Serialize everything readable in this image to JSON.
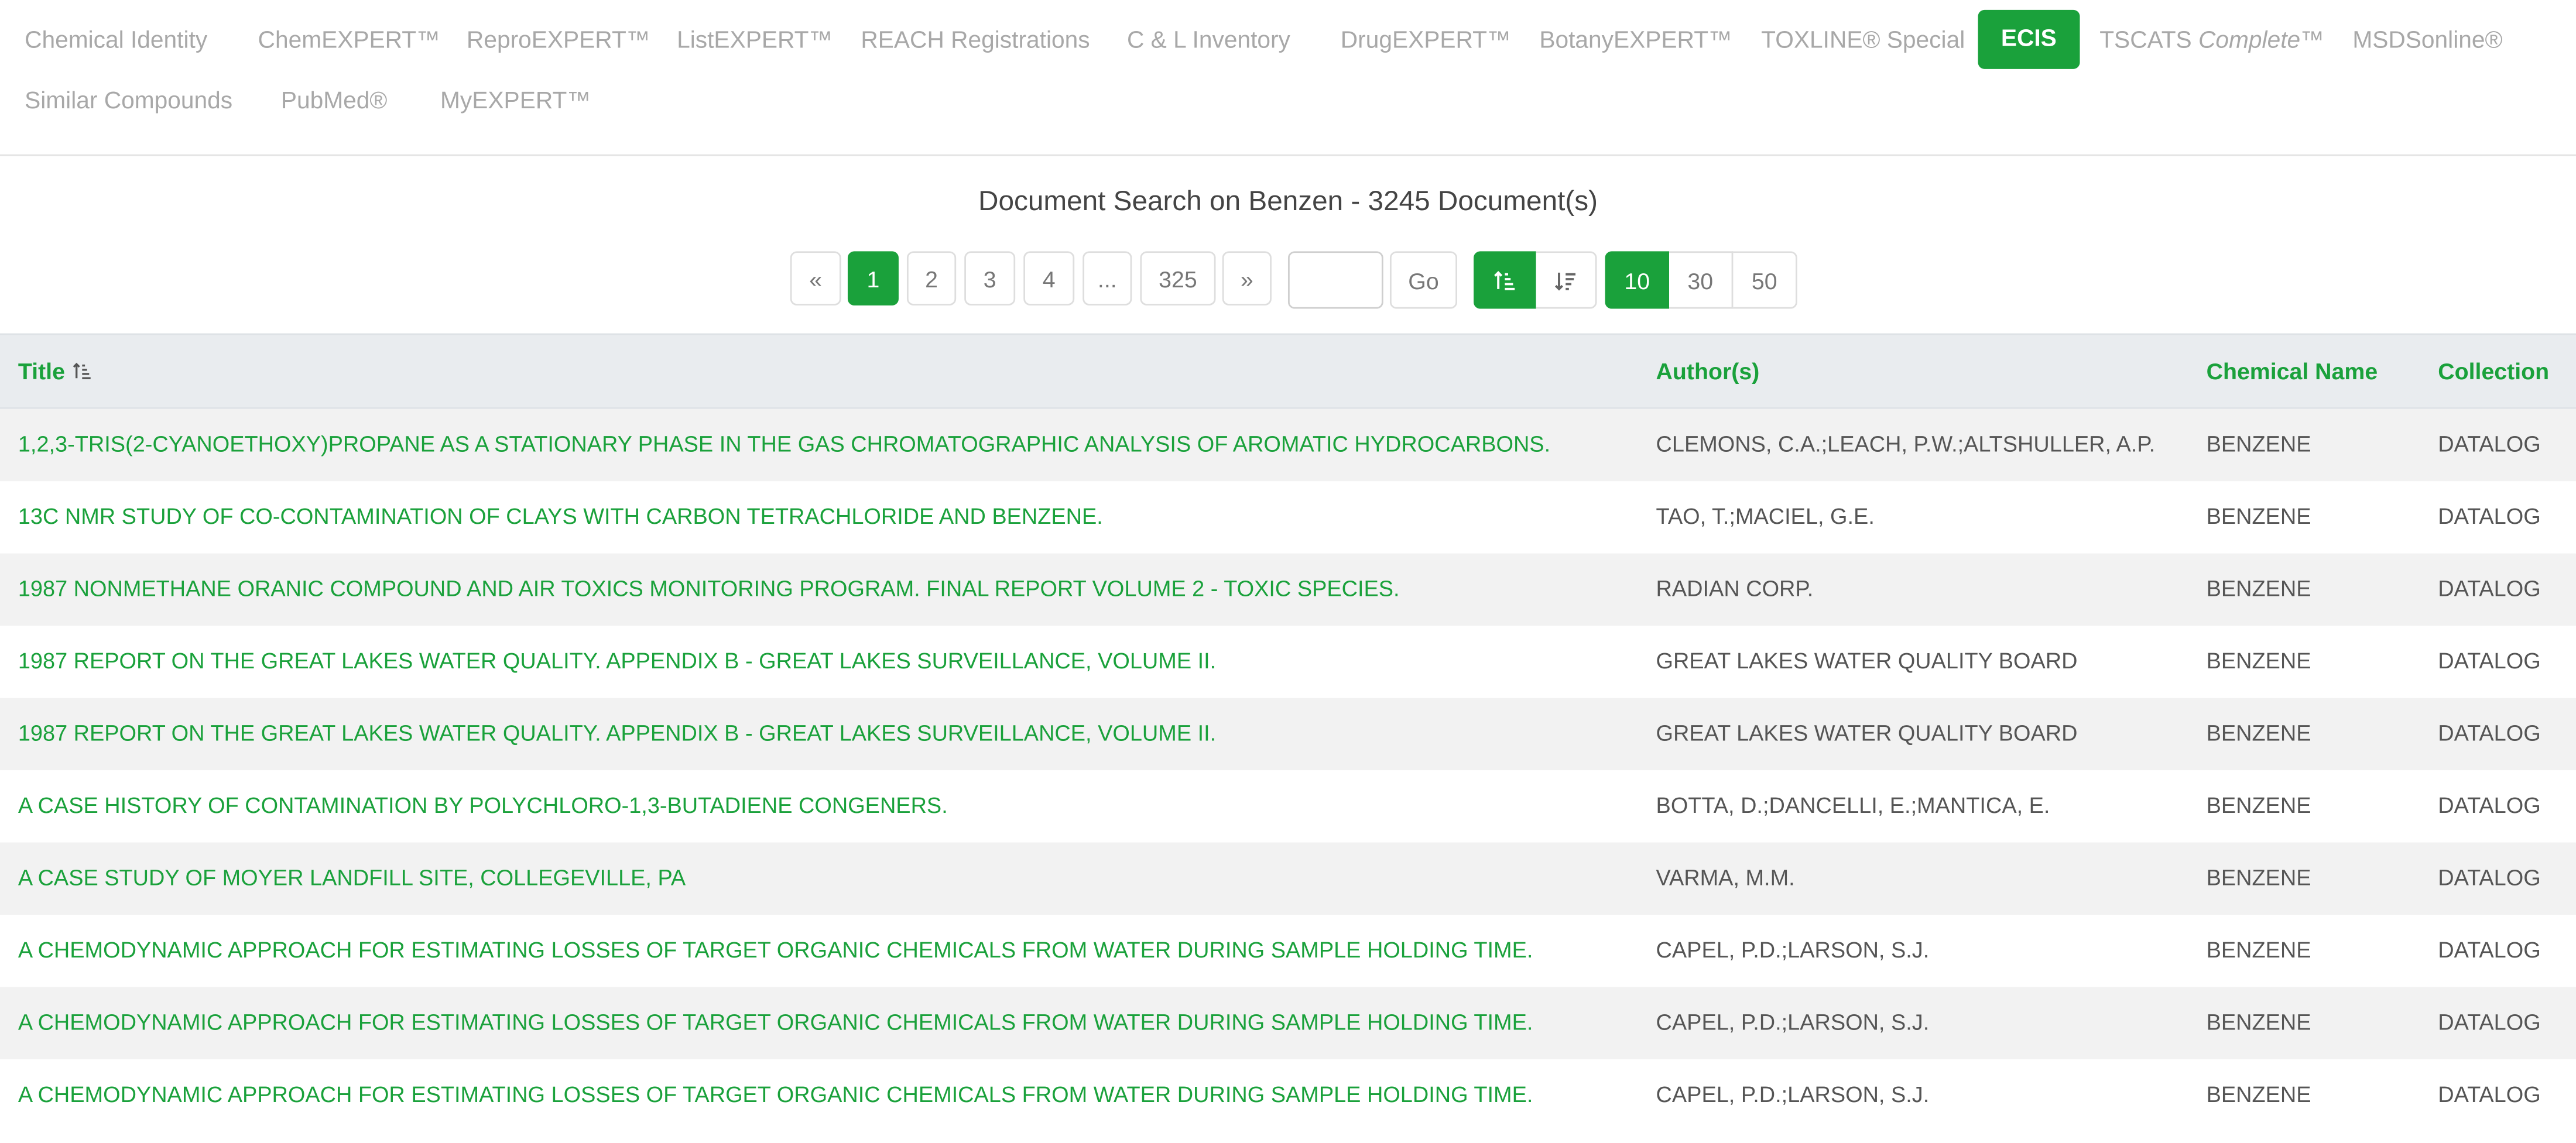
{
  "tabs": [
    {
      "label": "Chemical Identity"
    },
    {
      "label": "ChemEXPERT™"
    },
    {
      "label": "ReproEXPERT™"
    },
    {
      "label": "ListEXPERT™"
    },
    {
      "label": "REACH Registrations"
    },
    {
      "label": "C & L Inventory"
    },
    {
      "label": "DrugEXPERT™"
    },
    {
      "label": "BotanyEXPERT™"
    },
    {
      "label": "TOXLINE® Special"
    },
    {
      "label": "ECIS"
    },
    {
      "label_pre": "TSCATS ",
      "label_it": "Complete",
      "label_post": "™"
    },
    {
      "label": "MSDSonline®"
    },
    {
      "label": "Similar Compounds"
    },
    {
      "label": "PubMed®"
    },
    {
      "label": "MyEXPERT™"
    }
  ],
  "active_tab": "ECIS",
  "heading": "Document Search on Benzen - 3245 Document(s)",
  "pagination": {
    "prev": "«",
    "pages": [
      "1",
      "2",
      "3",
      "4",
      "...",
      "325"
    ],
    "next": "»",
    "current": "1",
    "page_input_value": "",
    "go_label": "Go",
    "page_sizes": [
      "10",
      "30",
      "50"
    ],
    "selected_page_size": "10"
  },
  "colors": {
    "accent": "#1aa13b",
    "header_bg": "#e9ecef",
    "stripe": "#f2f2f2"
  },
  "table": {
    "columns": {
      "title": "Title",
      "authors": "Author(s)",
      "chemical": "Chemical Name",
      "collection": "Collection"
    },
    "rows": [
      {
        "title": "1,2,3-TRIS(2-CYANOETHOXY)PROPANE AS A STATIONARY PHASE IN THE GAS CHROMATOGRAPHIC ANALYSIS OF AROMATIC HYDROCARBONS.",
        "authors": "CLEMONS, C.A.;LEACH, P.W.;ALTSHULLER, A.P.",
        "chemical": "BENZENE",
        "collection": "DATALOG"
      },
      {
        "title": "13C NMR STUDY OF CO-CONTAMINATION OF CLAYS WITH CARBON TETRACHLORIDE AND BENZENE.",
        "authors": "TAO, T.;MACIEL, G.E.",
        "chemical": "BENZENE",
        "collection": "DATALOG"
      },
      {
        "title": "1987 NONMETHANE ORANIC COMPOUND AND AIR TOXICS MONITORING PROGRAM. FINAL REPORT VOLUME 2 - TOXIC SPECIES.",
        "authors": "RADIAN CORP.",
        "chemical": "BENZENE",
        "collection": "DATALOG"
      },
      {
        "title": "1987 REPORT ON THE GREAT LAKES WATER QUALITY. APPENDIX B - GREAT LAKES SURVEILLANCE, VOLUME II.",
        "authors": "GREAT LAKES WATER QUALITY BOARD",
        "chemical": "BENZENE",
        "collection": "DATALOG"
      },
      {
        "title": "1987 REPORT ON THE GREAT LAKES WATER QUALITY. APPENDIX B - GREAT LAKES SURVEILLANCE, VOLUME II.",
        "authors": "GREAT LAKES WATER QUALITY BOARD",
        "chemical": "BENZENE",
        "collection": "DATALOG"
      },
      {
        "title": "A CASE HISTORY OF CONTAMINATION BY POLYCHLORO-1,3-BUTADIENE CONGENERS.",
        "authors": "BOTTA, D.;DANCELLI, E.;MANTICA, E.",
        "chemical": "BENZENE",
        "collection": "DATALOG"
      },
      {
        "title": "A CASE STUDY OF MOYER LANDFILL SITE, COLLEGEVILLE, PA",
        "authors": "VARMA, M.M.",
        "chemical": "BENZENE",
        "collection": "DATALOG"
      },
      {
        "title": "A CHEMODYNAMIC APPROACH FOR ESTIMATING LOSSES OF TARGET ORGANIC CHEMICALS FROM WATER DURING SAMPLE HOLDING TIME.",
        "authors": "CAPEL, P.D.;LARSON, S.J.",
        "chemical": "BENZENE",
        "collection": "DATALOG"
      },
      {
        "title": "A CHEMODYNAMIC APPROACH FOR ESTIMATING LOSSES OF TARGET ORGANIC CHEMICALS FROM WATER DURING SAMPLE HOLDING TIME.",
        "authors": "CAPEL, P.D.;LARSON, S.J.",
        "chemical": "BENZENE",
        "collection": "DATALOG"
      },
      {
        "title": "A CHEMODYNAMIC APPROACH FOR ESTIMATING LOSSES OF TARGET ORGANIC CHEMICALS FROM WATER DURING SAMPLE HOLDING TIME.",
        "authors": "CAPEL, P.D.;LARSON, S.J.",
        "chemical": "BENZENE",
        "collection": "DATALOG"
      }
    ]
  }
}
